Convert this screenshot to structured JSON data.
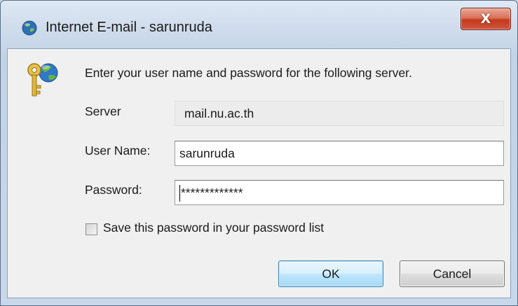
{
  "window": {
    "title": "Internet E-mail - sarunruda",
    "close_glyph": "X"
  },
  "dialog": {
    "prompt": "Enter your user name and password for the following server.",
    "server": {
      "label": "Server",
      "value": "mail.nu.ac.th"
    },
    "username": {
      "label": "User Name:",
      "value": "sarunruda"
    },
    "password": {
      "label": "Password:",
      "value": "*************"
    },
    "save_checkbox": {
      "label": "Save this password in your password list",
      "checked": false
    },
    "ok_label": "OK",
    "cancel_label": "Cancel"
  },
  "icons": {
    "app": "outlook-globe-icon",
    "prompt": "key-globe-icon",
    "close": "close-icon"
  },
  "colors": {
    "close_button": "#c4391f",
    "ok_button_border": "#3c7fb1",
    "window_frame": "#c8d7e9"
  }
}
